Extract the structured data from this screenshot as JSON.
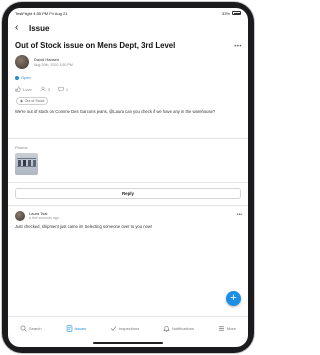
{
  "status_bar": {
    "left": "TestFlight  4:55 PM  Fri Aug 21",
    "battery": "33%"
  },
  "nav": {
    "title": "Issue"
  },
  "issue": {
    "title": "Out of Stock issue on Mens Dept, 3rd Level",
    "author": "David Hansen",
    "date": "Aug 20th, 2020 3:50 PM",
    "status": "Open",
    "reactions": {
      "like": "Love",
      "comments": "3",
      "replies": "1"
    },
    "tag": "Out of Stock",
    "body": "We're out of stock on Comme Des Garcons jeans, @Laura can you check if we have any in the warehouse?",
    "photos_label": "Photos"
  },
  "reply_label": "Reply",
  "comment": {
    "author": "Laura Tsai",
    "time": "a few seconds ago",
    "text": "Just checked, shipment just came in! Selecting someone over to you now!"
  },
  "tabs": [
    {
      "label": "Search",
      "icon": "search-icon"
    },
    {
      "label": "Issues",
      "icon": "issues-icon",
      "active": true
    },
    {
      "label": "Inspections",
      "icon": "inspections-icon"
    },
    {
      "label": "Notifications",
      "icon": "bell-icon"
    },
    {
      "label": "More",
      "icon": "menu-icon"
    }
  ],
  "colors": {
    "accent": "#1e8fe6",
    "status_open": "#2a8bd0"
  }
}
